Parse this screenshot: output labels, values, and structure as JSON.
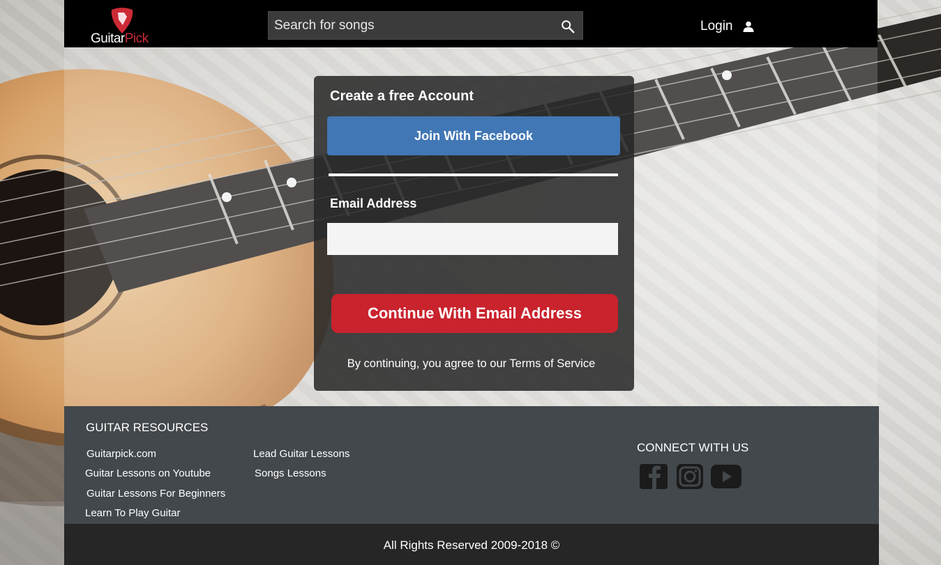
{
  "header": {
    "logo_text_1": "Guitar",
    "logo_text_2": "Pick",
    "search_placeholder": "Search for songs",
    "login_label": "Login"
  },
  "signup": {
    "title": "Create a free Account",
    "facebook_button": "Join With Facebook",
    "email_label": "Email Address",
    "email_value": "",
    "continue_button": "Continue With Email Address",
    "terms_text": "By continuing, you agree to our Terms of Service"
  },
  "footer": {
    "resources_title": "GUITAR RESOURCES",
    "links_col1": [
      "Guitarpick.com",
      "Guitar Lessons on Youtube",
      "Guitar Lessons For Beginners",
      "Learn To Play Guitar"
    ],
    "links_col2": [
      "Lead Guitar Lessons",
      "Songs Lessons"
    ],
    "connect_title": "CONNECT WITH US",
    "social_icons": [
      "facebook-icon",
      "instagram-icon",
      "youtube-icon"
    ],
    "copyright": "All Rights Reserved  2009-2018 ©"
  },
  "colors": {
    "header_bg": "#000000",
    "facebook_blue": "#4177b4",
    "brand_red": "#c9232d",
    "footer_bg": "#43484c",
    "copyright_bg": "#262626"
  }
}
